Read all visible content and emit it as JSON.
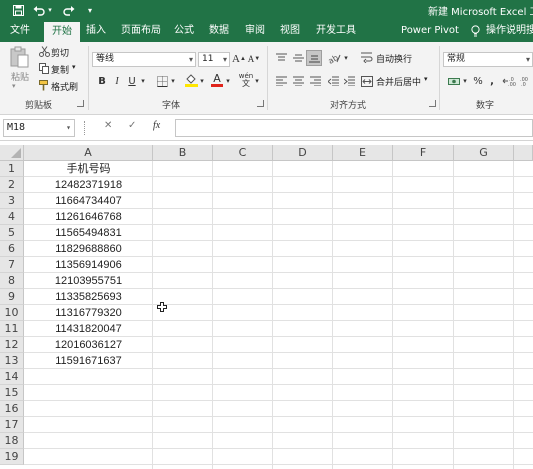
{
  "title_bar": {
    "title": "新建 Microsoft Excel 工作表",
    "quick_access": [
      "save-icon",
      "undo-icon",
      "redo-icon",
      "customize-icon"
    ]
  },
  "tabs": [
    {
      "label": "文件",
      "active": false
    },
    {
      "label": "开始",
      "active": true
    },
    {
      "label": "插入",
      "active": false
    },
    {
      "label": "页面布局",
      "active": false
    },
    {
      "label": "公式",
      "active": false
    },
    {
      "label": "数据",
      "active": false
    },
    {
      "label": "审阅",
      "active": false
    },
    {
      "label": "视图",
      "active": false
    },
    {
      "label": "开发工具",
      "active": false
    },
    {
      "label": "Power Pivot",
      "active": false
    }
  ],
  "tell_me": "操作说明搜",
  "ribbon": {
    "clipboard": {
      "paste": "粘贴",
      "cut": "剪切",
      "copy": "复制",
      "format_painter": "格式刷",
      "label": "剪贴板"
    },
    "font": {
      "font_name": "等线",
      "font_size": "11",
      "label": "字体",
      "bold": "B",
      "italic": "I",
      "underline": "U",
      "grow": "A",
      "shrink": "A",
      "font_color_letter": "A",
      "phonetic": "wén"
    },
    "alignment": {
      "wrap_text": "自动换行",
      "merge_center": "合并后居中",
      "label": "对齐方式"
    },
    "number": {
      "format": "常规",
      "percent": "%",
      "comma": ",",
      "label": "数字"
    }
  },
  "formula_bar": {
    "name_box": "M18",
    "cancel": "✕",
    "enter": "✓",
    "fx": "fx",
    "formula": ""
  },
  "columns": [
    "A",
    "B",
    "C",
    "D",
    "E",
    "F",
    "G"
  ],
  "rows": [
    "1",
    "2",
    "3",
    "4",
    "5",
    "6",
    "7",
    "8",
    "9",
    "10",
    "11",
    "12",
    "13",
    "14",
    "15",
    "16",
    "17",
    "18",
    "19"
  ],
  "cells_A": [
    "手机号码",
    "12482371918",
    "11664734407",
    "11261646768",
    "11565494831",
    "11829688860",
    "11356914906",
    "12103955751",
    "11335825693",
    "11316779320",
    "11431820047",
    "12016036127",
    "11591671637"
  ],
  "colors": {
    "excel_green": "#217346",
    "ribbon_bg": "#f3f3f3",
    "header_bg": "#e6e6e6",
    "font_color_bar": "#e0241c",
    "highlight_bar": "#ffe600"
  }
}
